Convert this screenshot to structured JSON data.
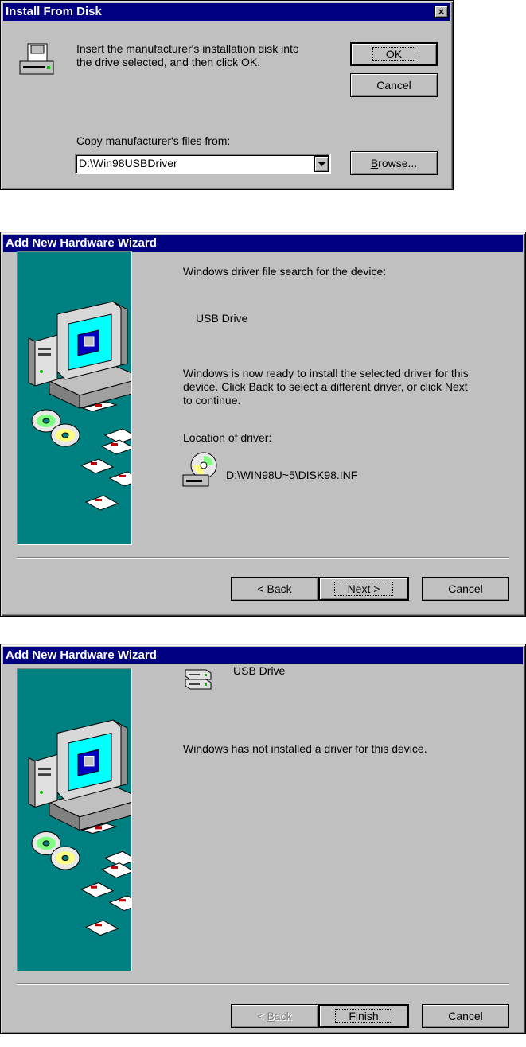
{
  "install_dialog": {
    "title": "Install From Disk",
    "close_label": "×",
    "message_line1": "Insert the manufacturer's installation disk into",
    "message_line2": "the drive selected, and then click OK.",
    "ok_label": "OK",
    "cancel_label": "Cancel",
    "copy_label": "Copy manufacturer's files from:",
    "path_value": "D:\\Win98USBDriver",
    "browse_prefix": "B",
    "browse_rest": "rowse..."
  },
  "wizard1": {
    "title": "Add New Hardware Wizard",
    "search_label": "Windows driver file search for the device:",
    "device_name": "USB Drive",
    "ready_line1": "Windows is now ready to install the selected driver for this",
    "ready_line2": "device. Click Back to select a different driver, or click Next",
    "ready_line3": "to continue.",
    "location_label": "Location of driver:",
    "driver_path": "D:\\WIN98U~5\\DISK98.INF",
    "back_prefix": "< ",
    "back_key": "B",
    "back_rest": "ack",
    "next_label": "Next >",
    "cancel_label": "Cancel"
  },
  "wizard2": {
    "title": "Add New Hardware Wizard",
    "device_name": "USB Drive",
    "status_text": "Windows has not installed a driver for this device.",
    "back_prefix": "< ",
    "back_key": "B",
    "back_rest": "ack",
    "finish_label": "Finish",
    "cancel_label": "Cancel"
  },
  "colors": {
    "title_bar": "#000080",
    "face": "#c0c0c0",
    "wizard_panel": "#008080"
  }
}
